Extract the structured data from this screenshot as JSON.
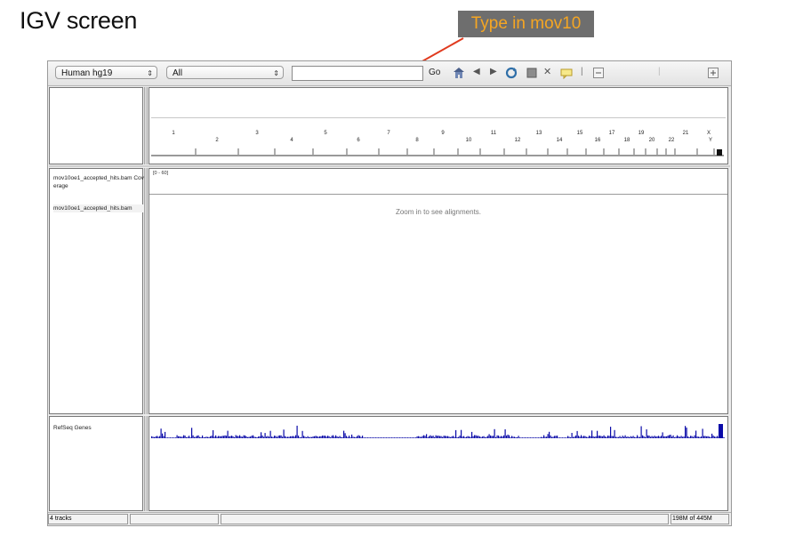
{
  "slide": {
    "title": "IGV screen",
    "callout": "Type in mov10"
  },
  "toolbar": {
    "genome": "Human hg19",
    "chromosome": "All",
    "locus_value": "",
    "go_label": "Go",
    "icons": [
      "home-icon",
      "back-icon",
      "forward-icon",
      "refresh-icon",
      "roi-icon",
      "resize-icon",
      "popup-text-icon",
      "divider",
      "zoom-out-icon",
      "zoom-in-icon"
    ]
  },
  "ideogram": {
    "chromosomes_top": [
      "1",
      "3",
      "5",
      "7",
      "9",
      "11",
      "13",
      "15",
      "17",
      "19",
      "21",
      "X"
    ],
    "chromosomes_bottom": [
      "2",
      "4",
      "6",
      "8",
      "10",
      "12",
      "14",
      "16",
      "18",
      "20",
      "22",
      "Y"
    ]
  },
  "alignment_panel": {
    "coverage_track": "mov10oe1_accepted_hits.bam Coverage",
    "alignment_track": "mov10oe1_accepted_hits.bam",
    "data_range": "[0 - 60]",
    "message": "Zoom in to see alignments."
  },
  "feature_panel": {
    "track": "RefSeq Genes",
    "gene_color": "#0a0aa8"
  },
  "status_bar": {
    "tracks": "4 tracks",
    "memory": "198M of 445M"
  },
  "colors": {
    "callout_bg": "#6e6e6e",
    "callout_text": "#f5a623",
    "arrow": "#e03a1e"
  }
}
